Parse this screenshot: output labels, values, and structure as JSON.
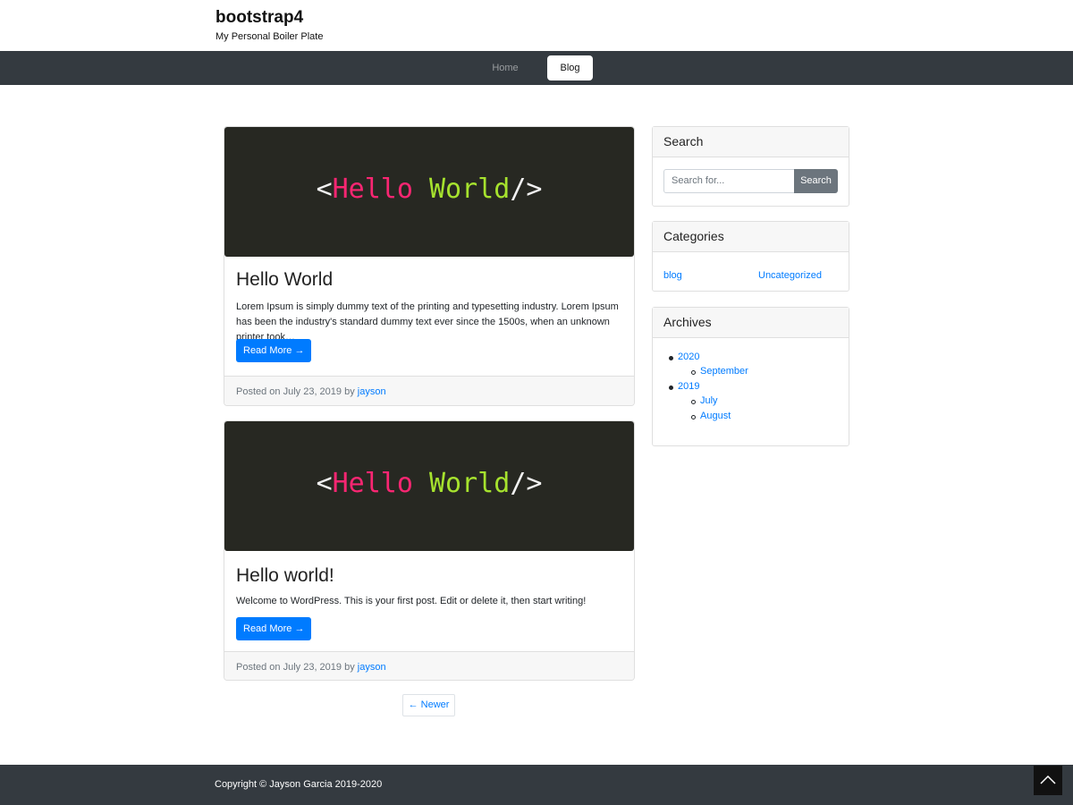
{
  "header": {
    "site_title": "bootstrap4",
    "tagline": "My Personal Boiler Plate"
  },
  "nav": {
    "items": [
      {
        "label": "Home",
        "active": false
      },
      {
        "label": "Blog",
        "active": true
      }
    ]
  },
  "posts": [
    {
      "image_code": {
        "open": "<",
        "word1": "Hello",
        "word2": "World",
        "close": "/>"
      },
      "title": "Hello World",
      "excerpt": "Lorem Ipsum is simply dummy text of the printing and typesetting industry. Lorem Ipsum has been the industry's standard dummy text ever since the 1500s, when an unknown printer took…",
      "read_more": "Read More →",
      "meta_prefix": "Posted on July 23, 2019 by",
      "author": "jayson"
    },
    {
      "image_code": {
        "open": "<",
        "word1": "Hello",
        "word2": "World",
        "close": "/>"
      },
      "title": "Hello world!",
      "excerpt": "Welcome to WordPress. This is your first post. Edit or delete it, then start writing!",
      "read_more": "Read More →",
      "meta_prefix": "Posted on July 23, 2019 by",
      "author": "jayson"
    }
  ],
  "pagination": {
    "newer": "← Newer"
  },
  "sidebar": {
    "search": {
      "title": "Search",
      "placeholder": "Search for...",
      "button": "Search"
    },
    "categories": {
      "title": "Categories",
      "items": [
        "blog",
        "Uncategorized"
      ]
    },
    "archives": {
      "title": "Archives",
      "years": [
        {
          "year": "2020",
          "months": [
            "September"
          ]
        },
        {
          "year": "2019",
          "months": [
            "July",
            "August"
          ]
        }
      ]
    }
  },
  "footer": {
    "copyright": "Copyright © Jayson Garcia 2019-2020",
    "back_to_top_icon": "chevron-up-icon"
  },
  "colors": {
    "navbar": "#343a40",
    "primary": "#007bff",
    "secondary": "#6c757d",
    "code_bg": "#272822",
    "code_pink": "#f92672",
    "code_green": "#a6e22e"
  }
}
